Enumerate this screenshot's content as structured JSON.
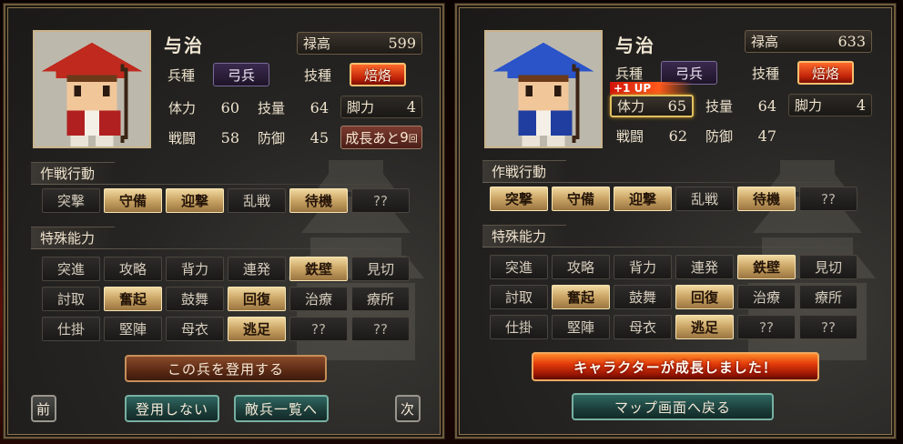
{
  "left": {
    "name": "与治",
    "stipend": {
      "label": "禄高",
      "value": "599"
    },
    "unit_type": {
      "label": "兵種",
      "value": "弓兵"
    },
    "technique": {
      "label": "技種",
      "value": "焙烙"
    },
    "stats": {
      "stamina": {
        "label": "体力",
        "value": "60"
      },
      "skill": {
        "label": "技量",
        "value": "64"
      },
      "legs": {
        "label": "脚力",
        "value": "4"
      },
      "combat": {
        "label": "戦闘",
        "value": "58"
      },
      "defense": {
        "label": "防御",
        "value": "45"
      }
    },
    "growth": {
      "label": "成長あと",
      "value": "9",
      "unit": "回"
    },
    "tactics_title": "作戦行動",
    "tactics": [
      {
        "label": "突撃",
        "on": false
      },
      {
        "label": "守備",
        "on": true
      },
      {
        "label": "迎撃",
        "on": true
      },
      {
        "label": "乱戦",
        "on": false
      },
      {
        "label": "待機",
        "on": true
      },
      {
        "label": "??",
        "on": false
      }
    ],
    "abilities_title": "特殊能力",
    "abilities": [
      {
        "label": "突進",
        "on": false
      },
      {
        "label": "攻略",
        "on": false
      },
      {
        "label": "背力",
        "on": false
      },
      {
        "label": "連発",
        "on": false
      },
      {
        "label": "鉄壁",
        "on": true
      },
      {
        "label": "見切",
        "on": false
      },
      {
        "label": "討取",
        "on": false
      },
      {
        "label": "奮起",
        "on": true
      },
      {
        "label": "鼓舞",
        "on": false
      },
      {
        "label": "回復",
        "on": true
      },
      {
        "label": "治療",
        "on": false
      },
      {
        "label": "療所",
        "on": false
      },
      {
        "label": "仕掛",
        "on": false
      },
      {
        "label": "堅陣",
        "on": false
      },
      {
        "label": "母衣",
        "on": false
      },
      {
        "label": "逃足",
        "on": true
      },
      {
        "label": "??",
        "on": false
      },
      {
        "label": "??",
        "on": false
      }
    ],
    "buttons": {
      "recruit": "この兵を登用する",
      "prev": "前",
      "decline": "登用しない",
      "enemy_list": "敵兵一覧へ",
      "next": "次"
    },
    "colors": {
      "armor": "#b02020",
      "hat": "#c02a1e"
    }
  },
  "right": {
    "name": "与治",
    "stipend": {
      "label": "禄高",
      "value": "633"
    },
    "unit_type": {
      "label": "兵種",
      "value": "弓兵"
    },
    "technique": {
      "label": "技種",
      "value": "焙烙"
    },
    "level_up_badge": "+1 UP",
    "stats": {
      "stamina": {
        "label": "体力",
        "value": "65"
      },
      "skill": {
        "label": "技量",
        "value": "64"
      },
      "legs": {
        "label": "脚力",
        "value": "4"
      },
      "combat": {
        "label": "戦闘",
        "value": "62"
      },
      "defense": {
        "label": "防御",
        "value": "47"
      }
    },
    "tactics_title": "作戦行動",
    "tactics": [
      {
        "label": "突撃",
        "on": true
      },
      {
        "label": "守備",
        "on": true
      },
      {
        "label": "迎撃",
        "on": true
      },
      {
        "label": "乱戦",
        "on": false
      },
      {
        "label": "待機",
        "on": true
      },
      {
        "label": "??",
        "on": false
      }
    ],
    "abilities_title": "特殊能力",
    "abilities": [
      {
        "label": "突進",
        "on": false
      },
      {
        "label": "攻略",
        "on": false
      },
      {
        "label": "背力",
        "on": false
      },
      {
        "label": "連発",
        "on": false
      },
      {
        "label": "鉄壁",
        "on": true
      },
      {
        "label": "見切",
        "on": false
      },
      {
        "label": "討取",
        "on": false
      },
      {
        "label": "奮起",
        "on": true
      },
      {
        "label": "鼓舞",
        "on": false
      },
      {
        "label": "回復",
        "on": true
      },
      {
        "label": "治療",
        "on": false
      },
      {
        "label": "療所",
        "on": false
      },
      {
        "label": "仕掛",
        "on": false
      },
      {
        "label": "堅陣",
        "on": false
      },
      {
        "label": "母衣",
        "on": false
      },
      {
        "label": "逃足",
        "on": true
      },
      {
        "label": "??",
        "on": false
      },
      {
        "label": "??",
        "on": false
      }
    ],
    "buttons": {
      "grown_banner": "キャラクターが成長しました！",
      "back_to_map": "マップ画面へ戻る"
    },
    "colors": {
      "armor": "#1f3ea0",
      "hat": "#2a54c8"
    }
  }
}
